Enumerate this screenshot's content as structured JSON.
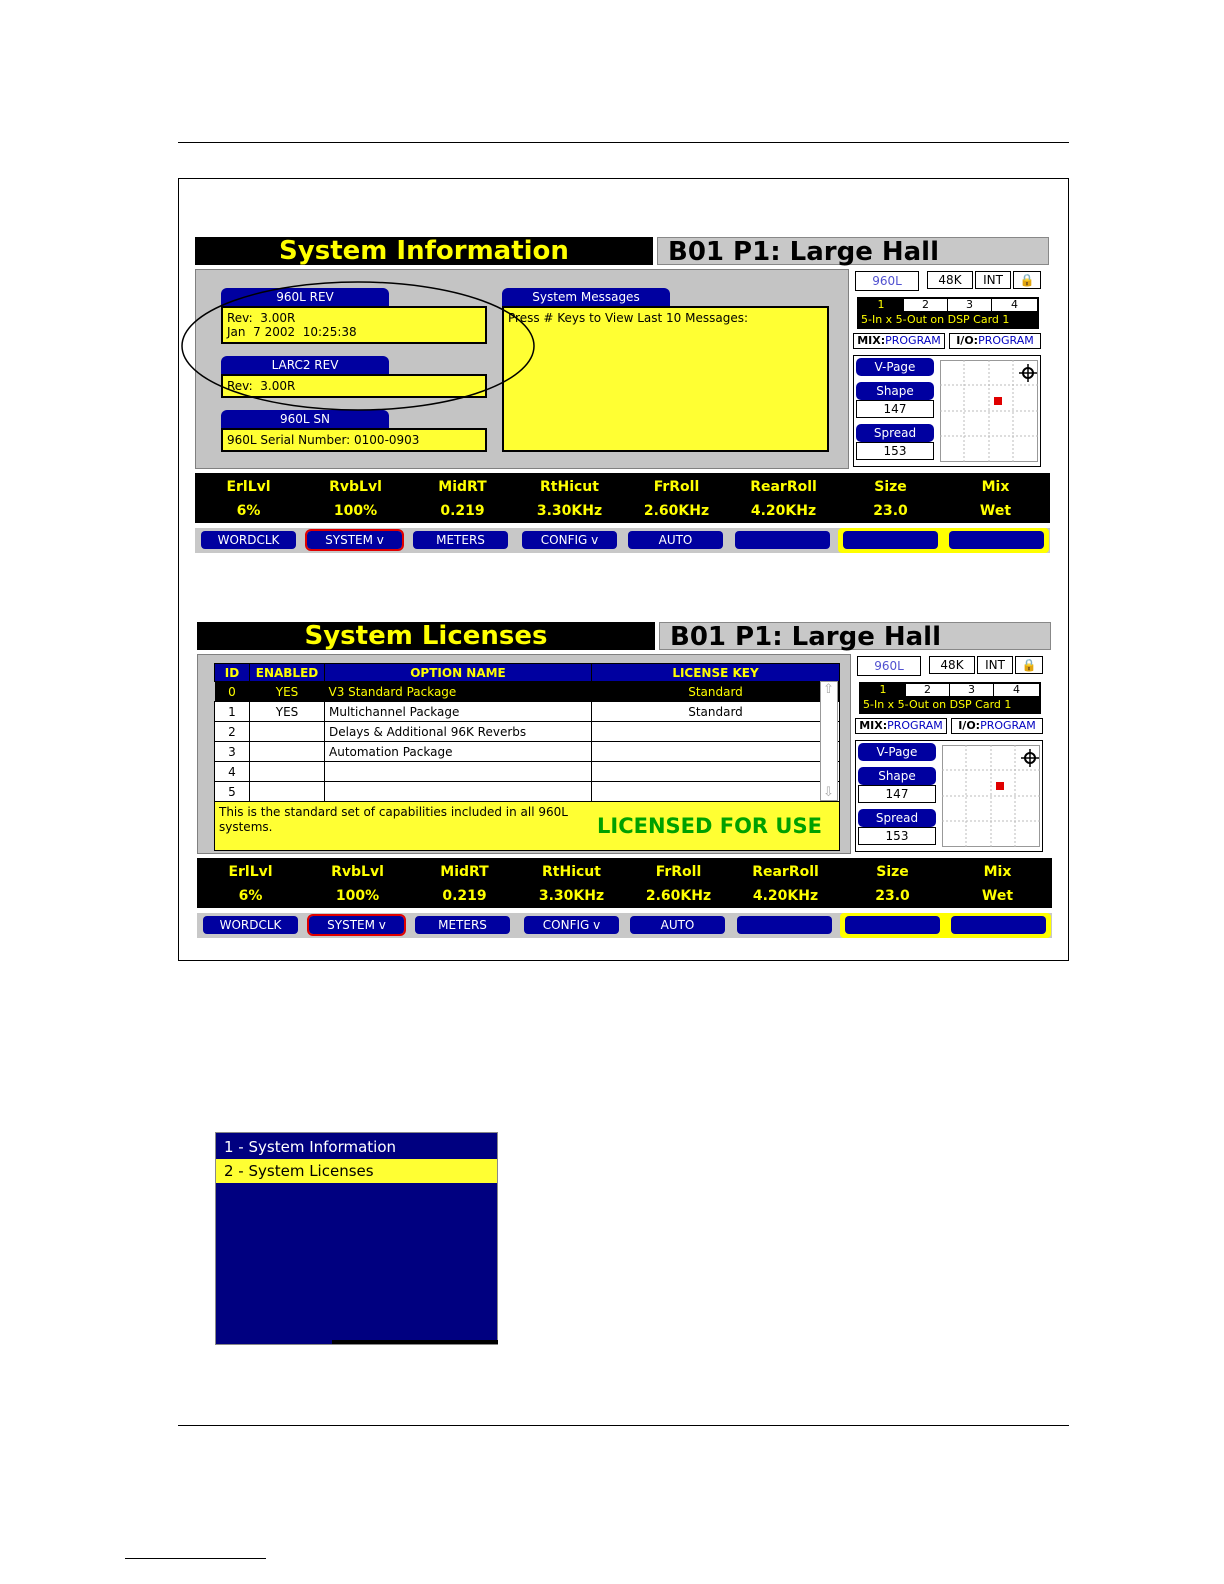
{
  "info_screen": {
    "title": "System Information",
    "preset": "B01 P1: Large Hall",
    "rev_960l": {
      "tab": "960L REV",
      "text": "Rev:  3.00R\nJan  7 2002  10:25:38"
    },
    "larc2_rev": {
      "tab": "LARC2 REV",
      "text": "Rev:  3.00R"
    },
    "sn": {
      "tab": "960L SN",
      "text": "960L Serial Number: 0100-0903"
    },
    "messages": {
      "tab": "System Messages",
      "text": "Press # Keys to View Last 10 Messages:"
    }
  },
  "licenses_screen": {
    "title": "System Licenses",
    "preset": "B01 P1: Large Hall",
    "columns": [
      "ID",
      "ENABLED",
      "OPTION NAME",
      "LICENSE KEY"
    ],
    "rows": [
      {
        "id": "0",
        "enabled": "YES",
        "name": "V3 Standard Package",
        "key": "Standard"
      },
      {
        "id": "1",
        "enabled": "YES",
        "name": "Multichannel Package",
        "key": "Standard"
      },
      {
        "id": "2",
        "enabled": "",
        "name": "Delays & Additional 96K Reverbs",
        "key": ""
      },
      {
        "id": "3",
        "enabled": "",
        "name": "Automation Package",
        "key": ""
      },
      {
        "id": "4",
        "enabled": "",
        "name": "",
        "key": ""
      },
      {
        "id": "5",
        "enabled": "",
        "name": "",
        "key": ""
      }
    ],
    "description": "This is the standard set of capabilities included in all 960L systems.",
    "status": "LICENSED FOR USE"
  },
  "status_panel": {
    "device": "960L",
    "rate": "48K",
    "clock": "INT",
    "cards": [
      "1",
      "2",
      "3",
      "4"
    ],
    "config": "5-In x 5-Out on DSP Card 1",
    "mix_label": "MIX:",
    "mix_value": "PROGRAM",
    "io_label": "I/O:",
    "io_value": "PROGRAM",
    "vpage": "V-Page",
    "shape_label": "Shape",
    "shape_value": "147",
    "spread_label": "Spread",
    "spread_value": "153"
  },
  "params": [
    {
      "name": "ErlLvl",
      "value": "6%"
    },
    {
      "name": "RvbLvl",
      "value": "100%"
    },
    {
      "name": "MidRT",
      "value": "0.219"
    },
    {
      "name": "RtHicut",
      "value": "3.30KHz"
    },
    {
      "name": "FrRoll",
      "value": "2.60KHz"
    },
    {
      "name": "RearRoll",
      "value": "4.20KHz"
    },
    {
      "name": "Size",
      "value": "23.0"
    },
    {
      "name": "Mix",
      "value": "Wet"
    }
  ],
  "softkeys": [
    "WORDCLK",
    "SYSTEM v",
    "METERS",
    "CONFIG v",
    "AUTO"
  ],
  "menu": [
    "1 - System Information",
    "2 - System Licenses"
  ]
}
